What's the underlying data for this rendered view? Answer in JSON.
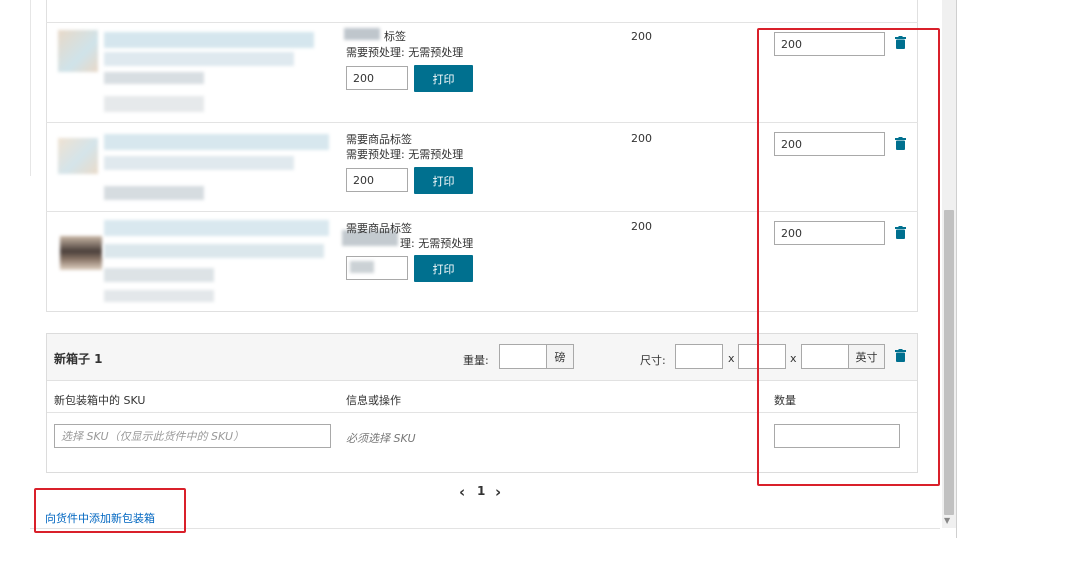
{
  "items": [
    {
      "label_line1": "标签",
      "label_line2": "需要预处理: 无需预处理",
      "print_qty": "200",
      "print_label": "打印",
      "expected_qty": "200",
      "box_qty": "200"
    },
    {
      "label_line1": "需要商品标签",
      "label_line2": "需要预处理: 无需预处理",
      "print_qty": "200",
      "print_label": "打印",
      "expected_qty": "200",
      "box_qty": "200"
    },
    {
      "label_line1": "需要商品标签",
      "label_line2": "理: 无需预处理",
      "print_qty": "",
      "print_label": "打印",
      "expected_qty": "200",
      "box_qty": "200"
    }
  ],
  "new_box": {
    "title": "新箱子 1",
    "weight_label": "重量:",
    "weight_value": "",
    "weight_unit": "磅",
    "dims_label": "尺寸:",
    "times_1": "x",
    "times_2": "x",
    "dim_unit": "英寸",
    "col_sku": "新包装箱中的 SKU",
    "col_info": "信息或操作",
    "col_qty": "数量",
    "sku_placeholder": "选择 SKU（仅显示此货件中的 SKU）",
    "info_text": "必须选择 SKU",
    "qty_value": ""
  },
  "pagination": {
    "prev": "‹",
    "current": "1",
    "next": "›"
  },
  "add_box_link": "向货件中添加新包装箱",
  "colors": {
    "primary_button": "#00708f",
    "annotation_red": "#d9202a",
    "trash_icon": "#00708f"
  }
}
